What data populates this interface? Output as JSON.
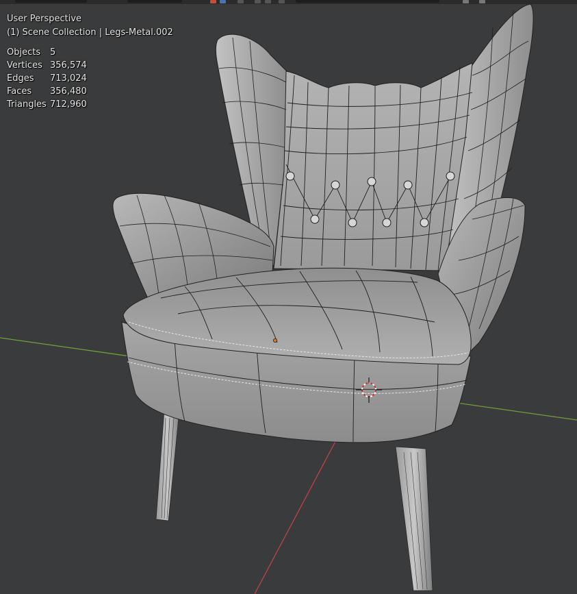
{
  "viewport": {
    "view_name": "User Perspective",
    "collection_line": "(1) Scene Collection | Legs-Metal.002"
  },
  "stats": [
    {
      "label": "Objects",
      "value": "5"
    },
    {
      "label": "Vertices",
      "value": "356,574"
    },
    {
      "label": "Edges",
      "value": "713,024"
    },
    {
      "label": "Faces",
      "value": "356,480"
    },
    {
      "label": "Triangles",
      "value": "712,960"
    }
  ],
  "colors": {
    "background": "#3a3b3c",
    "grid_x_axis": "#c0424a",
    "grid_y_axis": "#6fa138",
    "mesh_surface": "#a9a9a9",
    "wire": "#1e1e1e",
    "origin_dot": "#e07a1a",
    "cursor_red": "#d23232"
  },
  "icons": [
    "3d-cursor-icon",
    "object-origin-icon"
  ]
}
